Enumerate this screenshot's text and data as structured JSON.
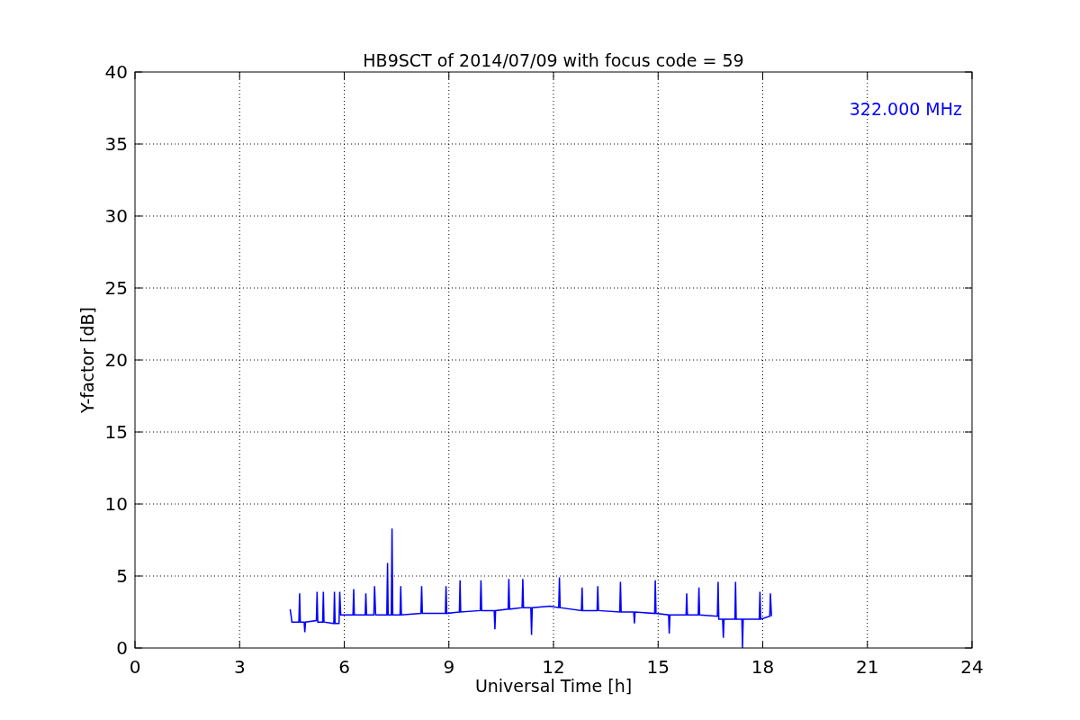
{
  "figure": {
    "chart_data": {
      "type": "line",
      "title": "HB9SCT of 2014/07/09 with focus code = 59",
      "xlabel": "Universal Time [h]",
      "ylabel": "Y-factor [dB]",
      "xlim": [
        0,
        24
      ],
      "ylim": [
        0,
        40
      ],
      "xticks": [
        0,
        3,
        6,
        9,
        12,
        15,
        18,
        21,
        24
      ],
      "yticks": [
        0,
        5,
        10,
        15,
        20,
        25,
        30,
        35,
        40
      ],
      "grid": true,
      "annotations": [
        "322.000 MHz"
      ],
      "x": [
        4.45,
        4.5,
        4.7,
        4.72,
        4.74,
        4.85,
        4.87,
        4.89,
        5.2,
        5.22,
        5.24,
        5.38,
        5.4,
        5.42,
        5.7,
        5.72,
        5.74,
        5.85,
        5.87,
        5.9,
        6.25,
        6.27,
        6.29,
        6.6,
        6.62,
        6.64,
        6.85,
        6.87,
        6.9,
        7.22,
        7.24,
        7.26,
        7.35,
        7.37,
        7.39,
        7.6,
        7.62,
        7.64,
        8.2,
        8.22,
        8.24,
        8.9,
        8.92,
        8.94,
        9.3,
        9.32,
        9.34,
        9.9,
        9.92,
        9.94,
        10.3,
        10.32,
        10.34,
        10.7,
        10.72,
        10.74,
        11.1,
        11.12,
        11.14,
        11.35,
        11.37,
        11.39,
        11.9,
        12.15,
        12.17,
        12.19,
        12.8,
        12.82,
        12.84,
        13.25,
        13.27,
        13.29,
        13.9,
        13.92,
        13.94,
        14.3,
        14.32,
        14.34,
        14.9,
        14.92,
        14.94,
        15.3,
        15.32,
        15.34,
        15.8,
        15.82,
        15.84,
        16.15,
        16.17,
        16.19,
        16.7,
        16.72,
        16.74,
        16.85,
        16.87,
        16.89,
        17.2,
        17.22,
        17.24,
        17.4,
        17.42,
        17.44,
        17.9,
        17.92,
        17.94,
        18.2,
        18.22,
        18.25
      ],
      "series": [
        {
          "color": "#0000ff",
          "values": [
            2.7,
            1.8,
            1.8,
            3.8,
            1.8,
            1.8,
            1.1,
            1.8,
            1.9,
            3.9,
            1.8,
            1.8,
            3.9,
            1.8,
            1.7,
            3.9,
            1.7,
            1.7,
            3.9,
            2.3,
            2.3,
            4.1,
            2.3,
            2.3,
            3.8,
            2.3,
            2.3,
            4.3,
            2.3,
            2.3,
            5.9,
            2.3,
            2.3,
            8.3,
            2.3,
            2.3,
            4.3,
            2.3,
            2.4,
            4.3,
            2.4,
            2.4,
            4.3,
            2.4,
            2.5,
            4.7,
            2.5,
            2.6,
            4.7,
            2.6,
            2.6,
            1.3,
            2.6,
            2.7,
            4.8,
            2.7,
            2.8,
            4.8,
            2.8,
            2.8,
            0.9,
            2.8,
            2.9,
            2.8,
            4.9,
            2.8,
            2.6,
            4.2,
            2.6,
            2.6,
            4.3,
            2.6,
            2.5,
            4.6,
            2.5,
            2.5,
            1.7,
            2.5,
            2.4,
            4.7,
            2.4,
            2.3,
            1.0,
            2.3,
            2.3,
            3.8,
            2.3,
            2.3,
            4.2,
            2.3,
            2.2,
            4.6,
            2.0,
            2.0,
            0.7,
            2.0,
            2.0,
            4.6,
            2.0,
            2.0,
            0.0,
            2.0,
            2.0,
            3.9,
            2.0,
            2.2,
            3.8,
            2.2
          ]
        }
      ]
    }
  }
}
